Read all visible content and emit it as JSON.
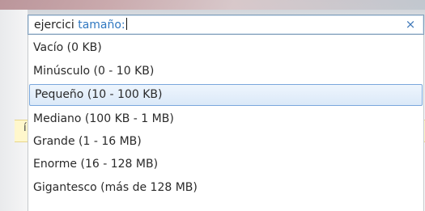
{
  "search": {
    "query": "ejercici",
    "keyword": "tamaño:",
    "clear_icon": "×"
  },
  "size_filter": {
    "selected_index": 2,
    "options": [
      {
        "label": "Vacío (0 KB)"
      },
      {
        "label": "Minúsculo (0 - 10 KB)"
      },
      {
        "label": "Pequeño (10 - 100 KB)"
      },
      {
        "label": "Mediano (100 KB - 1 MB)"
      },
      {
        "label": "Grande (1 - 16 MB)"
      },
      {
        "label": "Enorme (16 - 128 MB)"
      },
      {
        "label": "Gigantesco (más de 128 MB)"
      }
    ]
  },
  "background": {
    "partial_glyph": "í"
  },
  "colors": {
    "keyword": "#2f77c0",
    "selection_border": "#7aa7dc",
    "selection_fill": "#dbe9f8",
    "clear_icon": "#3f78b8"
  }
}
